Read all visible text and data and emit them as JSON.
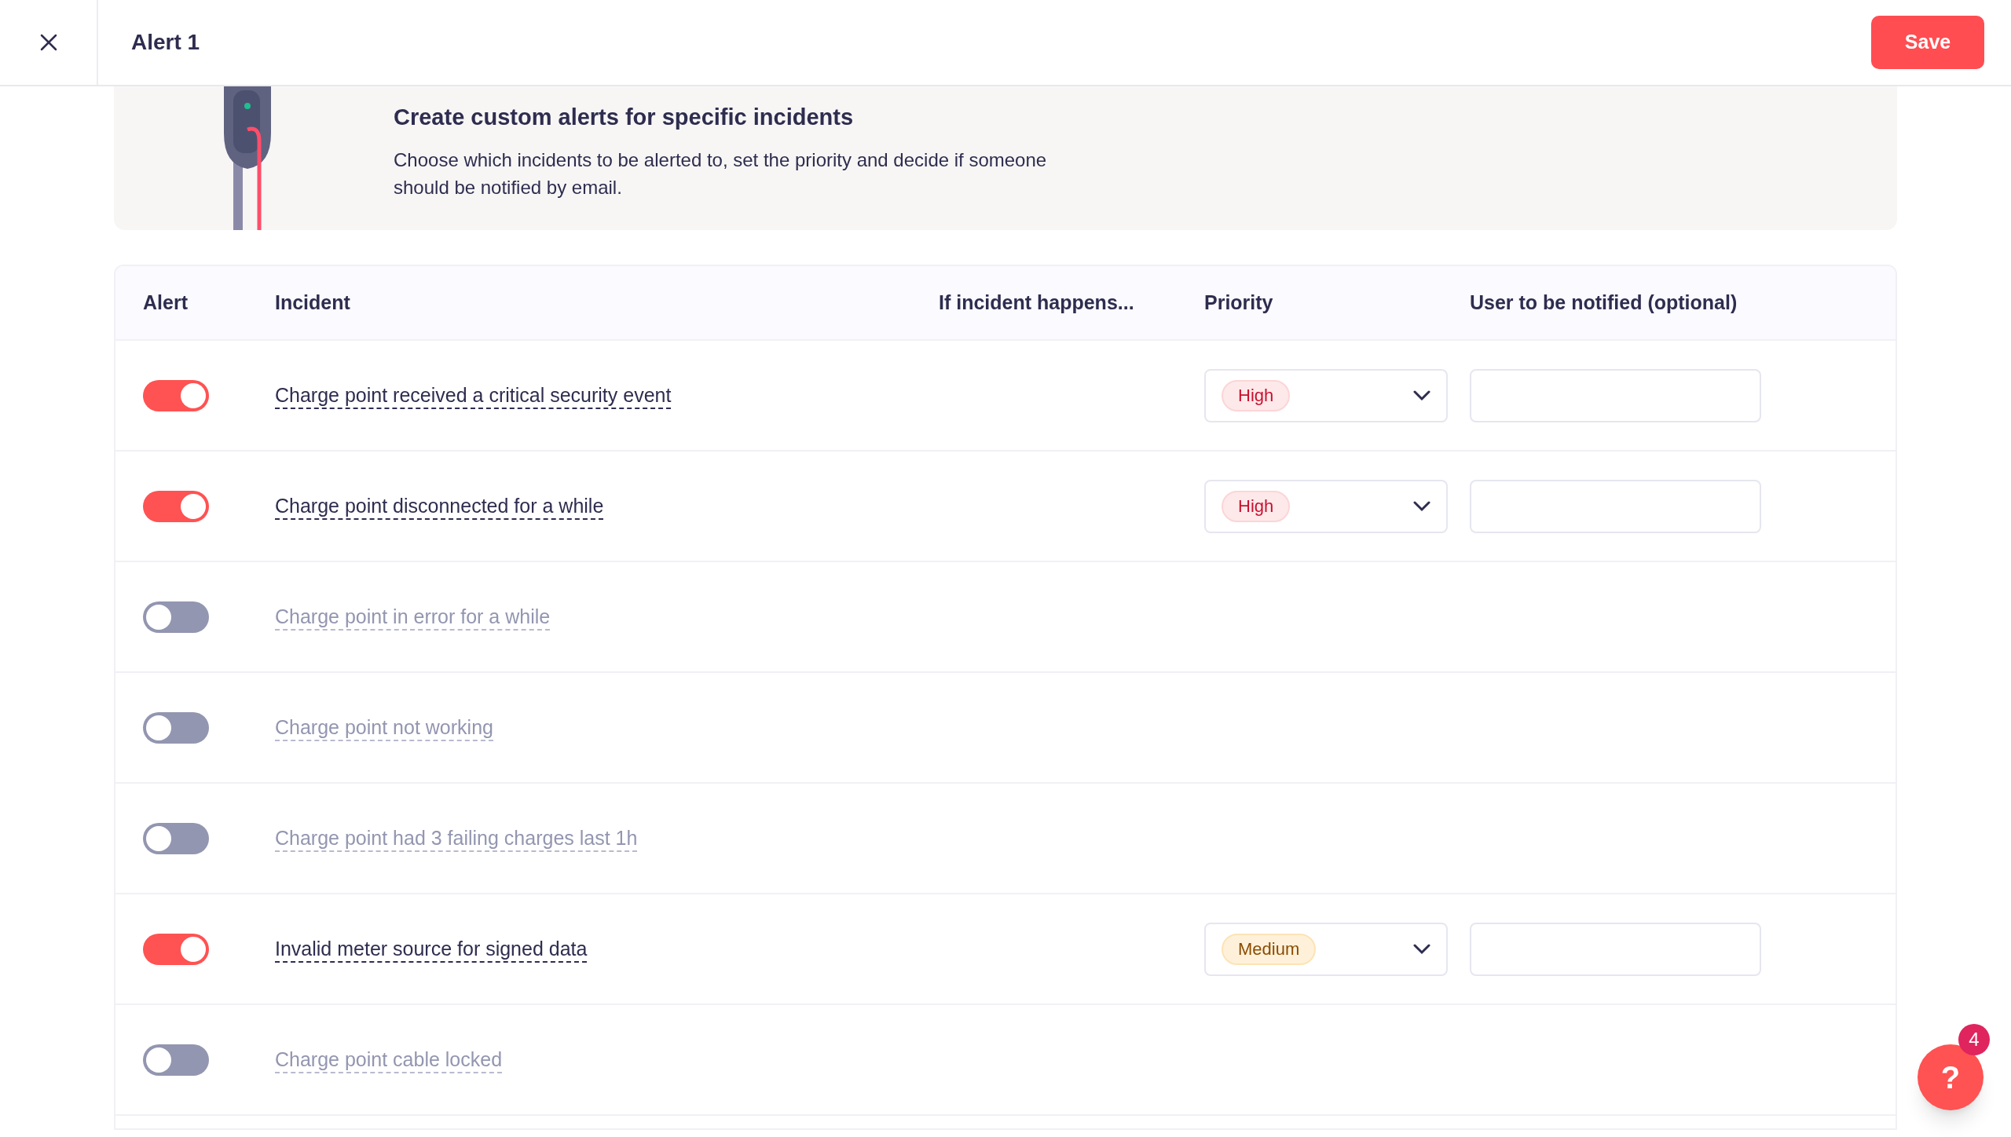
{
  "header": {
    "title": "Alert 1",
    "save_label": "Save"
  },
  "banner": {
    "title": "Create custom alerts for specific incidents",
    "description": "Choose which incidents to be alerted to, set the priority and decide if someone should be notified by email."
  },
  "table": {
    "columns": [
      "Alert",
      "Incident",
      "If incident happens...",
      "Priority",
      "User to be notified (optional)"
    ],
    "rows": [
      {
        "enabled": true,
        "incident": "Charge point received a critical security event",
        "priority": {
          "label": "High",
          "kind": "high"
        }
      },
      {
        "enabled": true,
        "incident": "Charge point disconnected for a while",
        "priority": {
          "label": "High",
          "kind": "high"
        }
      },
      {
        "enabled": false,
        "incident": "Charge point in error for a while"
      },
      {
        "enabled": false,
        "incident": "Charge point not working"
      },
      {
        "enabled": false,
        "incident": "Charge point had 3 failing charges last 1h"
      },
      {
        "enabled": true,
        "incident": "Invalid meter source for signed data",
        "priority": {
          "label": "Medium",
          "kind": "medium"
        }
      },
      {
        "enabled": false,
        "incident": "Charge point cable locked"
      }
    ]
  },
  "help": {
    "label": "?",
    "badge": "4"
  }
}
